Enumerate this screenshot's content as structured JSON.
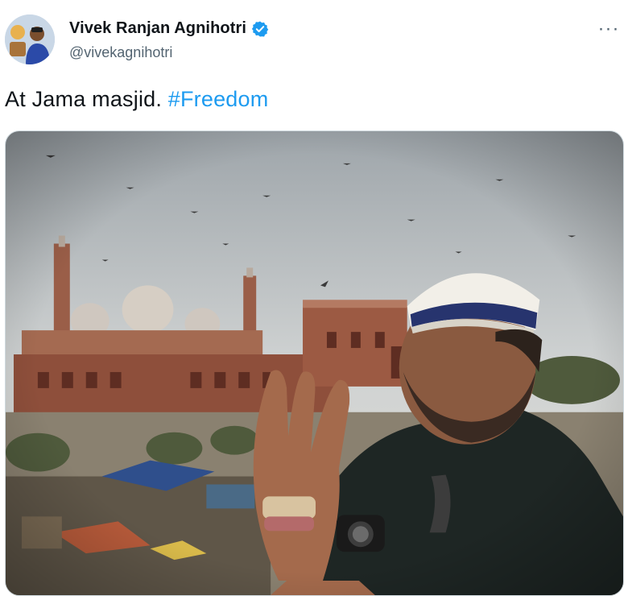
{
  "author": {
    "display_name": "Vivek Ranjan Agnihotri",
    "handle": "@vivekagnihotri",
    "verified": true
  },
  "tweet": {
    "text": "At Jama masjid.",
    "hashtag": "#Freedom"
  },
  "more_menu": {
    "label": "···"
  },
  "colors": {
    "hashtag": "#1d9bf0",
    "verified_badge": "#1d9bf0",
    "handle": "#536471"
  },
  "media": {
    "description_icon": "photo"
  }
}
